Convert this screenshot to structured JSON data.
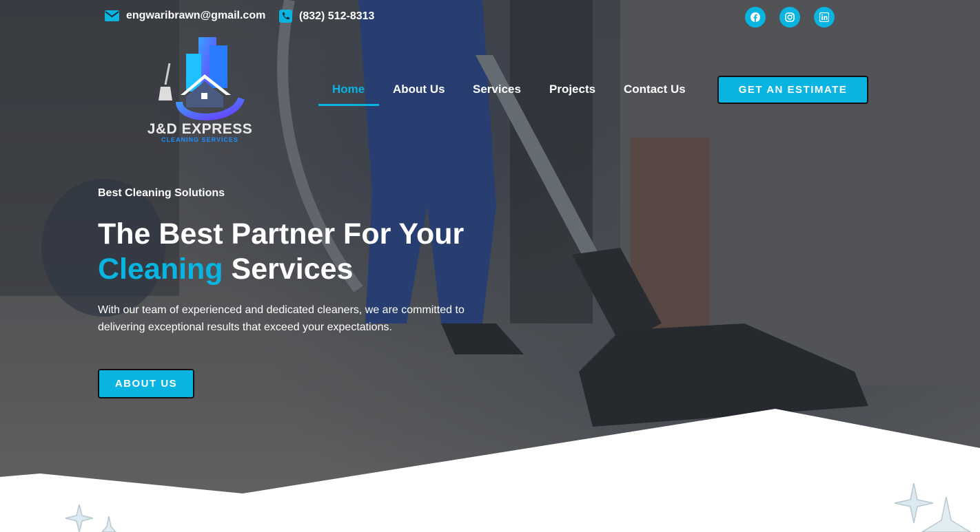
{
  "topbar": {
    "email": "engwaribrawn@gmail.com",
    "phone": "(832) 512-8313",
    "social": [
      "facebook-icon",
      "instagram-icon",
      "linkedin-icon"
    ]
  },
  "logo": {
    "name": "J&D EXPRESS",
    "subtitle": "CLEANING SERVICES"
  },
  "nav": {
    "items": [
      {
        "label": "Home",
        "active": true
      },
      {
        "label": "About Us",
        "active": false
      },
      {
        "label": "Services",
        "active": false
      },
      {
        "label": "Projects",
        "active": false
      },
      {
        "label": "Contact Us",
        "active": false
      }
    ],
    "cta": "GET AN ESTIMATE"
  },
  "hero": {
    "tagline": "Best Cleaning Solutions",
    "headline_line1": "The Best Partner For Your",
    "headline_accent": "Cleaning",
    "headline_rest": " Services",
    "description": "With our team of experienced and dedicated cleaners, we are committed to delivering exceptional results that exceed your expectations.",
    "button": "ABOUT US"
  },
  "colors": {
    "accent": "#0ab4e0",
    "text": "#ffffff"
  }
}
